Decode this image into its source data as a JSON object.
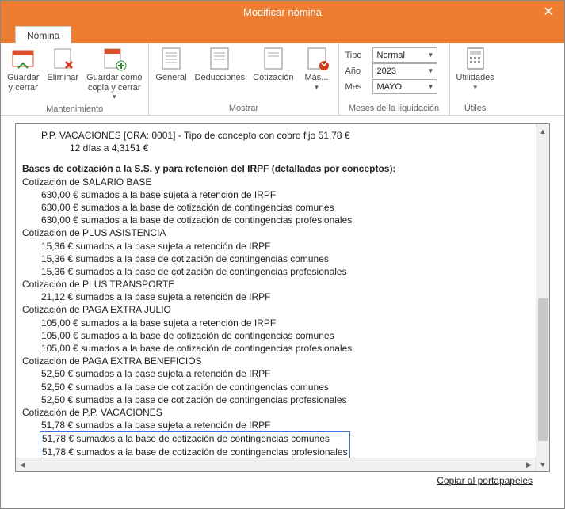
{
  "window": {
    "title": "Modificar nómina"
  },
  "tabs": {
    "nomina": "Nómina"
  },
  "ribbon": {
    "mantenimiento": {
      "label": "Mantenimiento",
      "guardar_cerrar": "Guardar\ny cerrar",
      "eliminar": "Eliminar",
      "guardar_copia": "Guardar como\ncopia y cerrar"
    },
    "mostrar": {
      "label": "Mostrar",
      "general": "General",
      "deducciones": "Deducciones",
      "cotizacion": "Cotización",
      "mas": "Más..."
    },
    "meses": {
      "label": "Meses de la liquidación",
      "tipo_label": "Tipo",
      "tipo_value": "Normal",
      "ano_label": "Año",
      "ano_value": "2023",
      "mes_label": "Mes",
      "mes_value": "MAYO"
    },
    "utiles": {
      "label": "Útiles",
      "utilidades": "Utilidades"
    }
  },
  "doc": {
    "l0": "P.P. VACACIONES [CRA: 0001] - Tipo de concepto con cobro fijo 51,78 €",
    "l0b": "12 días a 4,3151 €",
    "h1": "Bases de cotización a la S.S. y para retención del IRPF (detalladas por conceptos):",
    "c1": "Cotización de SALARIO BASE",
    "c1a": "630,00 € sumados a la base sujeta a retención de IRPF",
    "c1b": "630,00 € sumados a la base de cotización de contingencias comunes",
    "c1c": "630,00 € sumados a la base de cotización de contingencias profesionales",
    "c2": "Cotización de PLUS ASISTENCIA",
    "c2a": "15,36 € sumados a la base sujeta a retención de IRPF",
    "c2b": "15,36 € sumados a la base de cotización de contingencias comunes",
    "c2c": "15,36 € sumados a la base de cotización de contingencias profesionales",
    "c3": "Cotización de PLUS TRANSPORTE",
    "c3a": "21,12 € sumados a la base sujeta a retención de IRPF",
    "c4": "Cotización de PAGA EXTRA JULIO",
    "c4a": "105,00 € sumados a la base sujeta a retención de IRPF",
    "c4b": "105,00 € sumados a la base de cotización de contingencias comunes",
    "c4c": "105,00 € sumados a la base de cotización de contingencias profesionales",
    "c5": "Cotización de PAGA EXTRA BENEFICIOS",
    "c5a": "52,50 € sumados a la base sujeta a retención de IRPF",
    "c5b": "52,50 € sumados a la base de cotización de contingencias comunes",
    "c5c": "52,50 € sumados a la base de cotización de contingencias profesionales",
    "c6": "Cotización de P.P. VACACIONES",
    "c6a": "51,78 € sumados a la base sujeta a retención de IRPF",
    "c6b": "51,78 € sumados a la base de cotización de contingencias comunes",
    "c6c": "51,78 € sumados a la base de cotización de contingencias profesionales"
  },
  "footer": {
    "copy": "Copiar al portapapeles"
  }
}
